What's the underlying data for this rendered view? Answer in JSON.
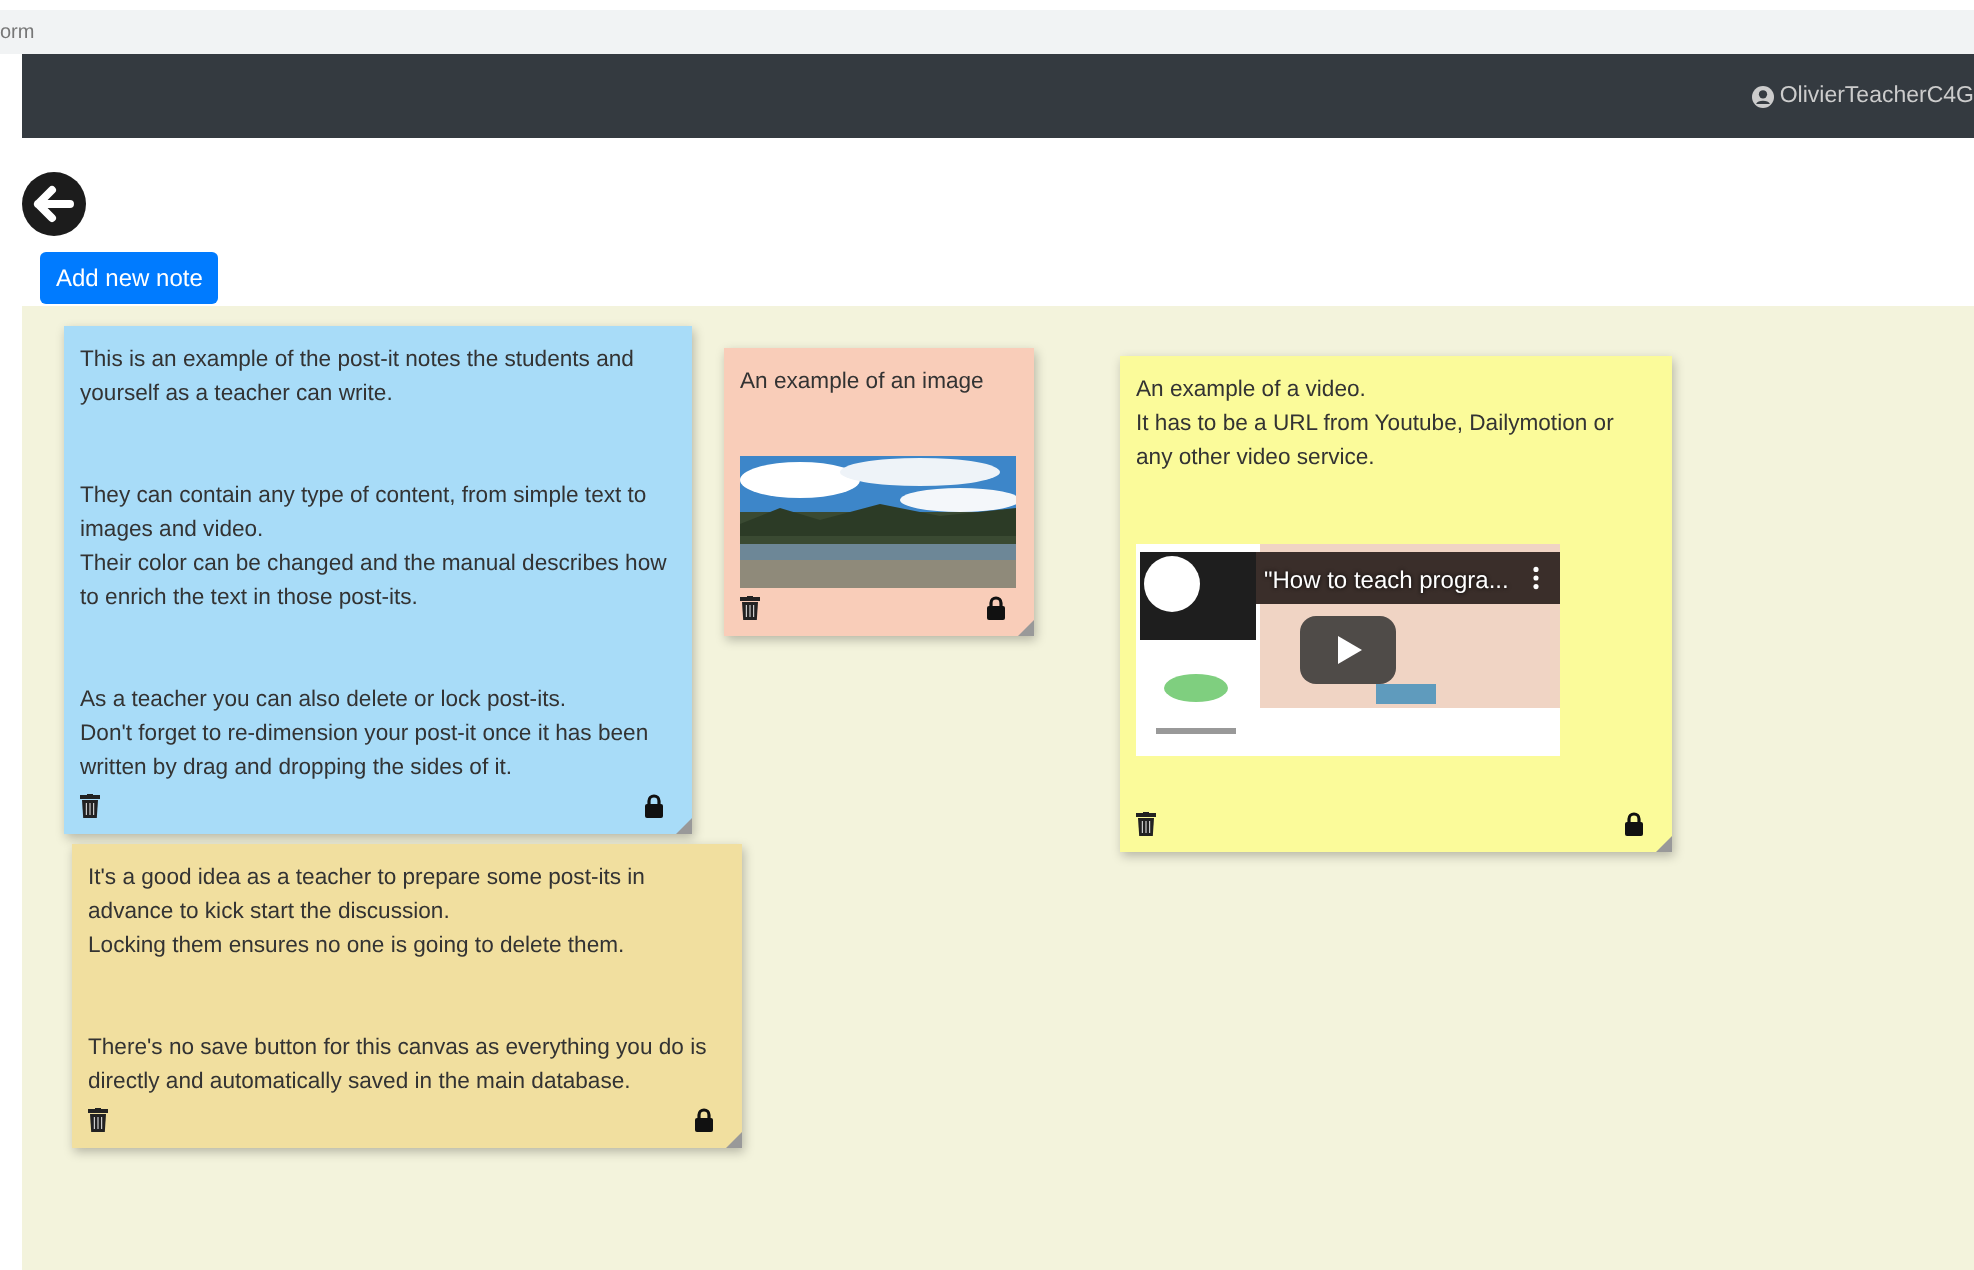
{
  "address_bar": {
    "text": "orm"
  },
  "navbar": {
    "user": "OlivierTeacherC4G"
  },
  "add_button": "Add new note",
  "notes": [
    {
      "color": "#a8dcf8",
      "locked": true,
      "paragraphs": [
        [
          "This is an example of the post-it notes the students and yourself as a teacher can write."
        ],
        [
          "They can contain any type of content, from simple text to images and video.",
          "Their color can be changed and the manual describes how to enrich the text in those post-its."
        ],
        [
          "As a teacher you can also delete or lock post-its.",
          "Don't forget to re-dimension your post-it once it has been written by drag and dropping the sides of it."
        ]
      ]
    },
    {
      "color": "#f9cdb9",
      "locked": true,
      "paragraphs": [
        [
          "An example of an image"
        ]
      ],
      "media": {
        "kind": "picture"
      }
    },
    {
      "color": "#fbfb9a",
      "locked": true,
      "paragraphs": [
        [
          "An example of a video.",
          "It has to be a URL from Youtube, Dailymotion or any other video service."
        ]
      ],
      "media": {
        "kind": "video",
        "title": "\"How to teach progra..."
      }
    },
    {
      "color": "#f1df9f",
      "locked": true,
      "paragraphs": [
        [
          "It's a good idea as a teacher to prepare some post-its in advance to kick start the discussion.",
          "Locking them ensures no one is going to delete them."
        ],
        [
          "There's no save button for this canvas as everything you do is directly and automatically saved in the main database."
        ]
      ]
    }
  ]
}
